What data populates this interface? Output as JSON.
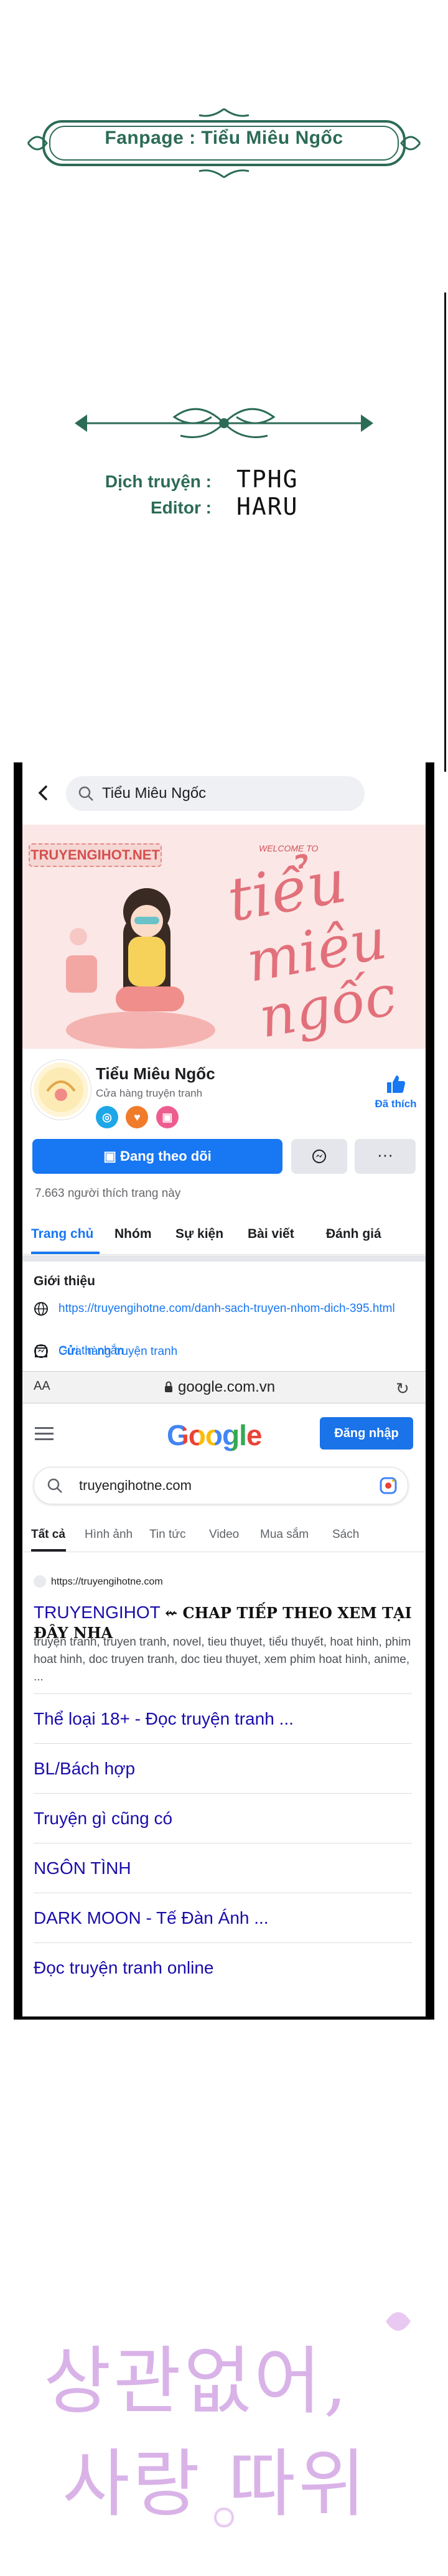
{
  "credits": {
    "fanpage": "Fanpage : Tiểu Miêu Ngốc",
    "translator_label": "Dịch truyện :",
    "translator": "TPHG",
    "editor_label": "Editor :",
    "editor": "HARU"
  },
  "facebook": {
    "search_text": "Tiểu Miêu Ngốc",
    "cover": {
      "logo": "TRUYENGIHOT.NET",
      "welcome": "WELCOME TO",
      "title_lines": [
        "tiểu",
        "miêu",
        "ngốc"
      ]
    },
    "page_name": "Tiểu Miêu Ngốc",
    "category": "Cửa hàng truyện tranh",
    "liked_label": "Đã thích",
    "follow_label": "Đang theo dõi",
    "more_label": "···",
    "likes_count": "7.663 người thích trang này",
    "tabs": [
      "Trang chủ",
      "Nhóm",
      "Sự kiện",
      "Bài viết",
      "Đánh giá"
    ],
    "intro_title": "Giới thiệu",
    "intro_link": "https://truyengihotne.com/danh-sach-truyen-nhom-dich-395.html",
    "intro_message": "Gửi tin nhắn",
    "intro_shop": "Cửa hàng truyện tranh",
    "colors": {
      "fb_blue": "#1877f2"
    }
  },
  "browser": {
    "aa": "AA",
    "domain": "google.com.vn",
    "reload_icon": "↻"
  },
  "google": {
    "logo": "Google",
    "login_label": "Đăng nhập",
    "query": "truyengihotne.com",
    "tabs": [
      "Tất cả",
      "Hình ảnh",
      "Tin tức",
      "Video",
      "Mua sắm",
      "Sách"
    ],
    "result": {
      "site": "https://truyengihotne.com",
      "title": "TRUYENGIHOT",
      "title_highlight": "⇜ CHAP TIẾP THEO XEM TẠI ĐÂY NHA",
      "snippet": "truyện tranh, truyen tranh, novel, tieu thuyet, tiểu thuyết, hoat hinh, phim hoat hinh, doc truyen tranh, doc tieu thuyet, xem phim hoat hinh, anime, ...",
      "sitelinks": [
        "Thể loại 18+ - Đọc truyện tranh ...",
        "BL/Bách hợp",
        "Truyện gì cũng có",
        "NGÔN TÌNH",
        "DARK MOON - Tế Đàn Ánh ...",
        "Đọc truyện tranh online"
      ]
    }
  },
  "bottom_title": {
    "line1": "상관없어,",
    "line2": "사랑 따위"
  }
}
